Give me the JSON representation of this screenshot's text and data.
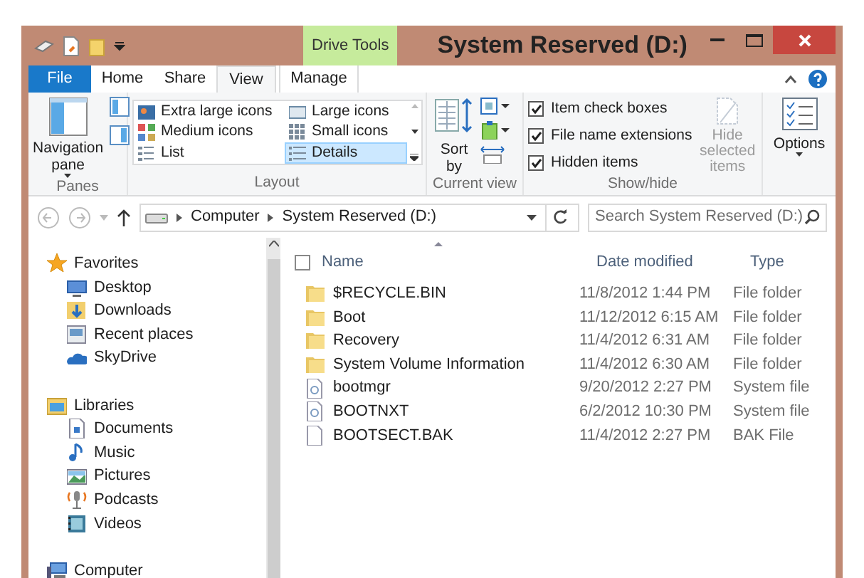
{
  "window": {
    "title": "System Reserved (D:)",
    "contextual_tab": "Drive Tools"
  },
  "ribbon_tabs": [
    {
      "label": "File",
      "kind": "file",
      "selected": false
    },
    {
      "label": "Home",
      "kind": "tab",
      "selected": false
    },
    {
      "label": "Share",
      "kind": "tab",
      "selected": false
    },
    {
      "label": "View",
      "kind": "tab",
      "selected": true
    },
    {
      "label": "Manage",
      "kind": "tab",
      "selected": false
    }
  ],
  "ribbon": {
    "panes": {
      "label": "Panes",
      "button": "Navigation pane"
    },
    "layout": {
      "label": "Layout",
      "options": [
        {
          "label": "Extra large icons",
          "selected": false
        },
        {
          "label": "Large icons",
          "selected": false
        },
        {
          "label": "Medium icons",
          "selected": false
        },
        {
          "label": "Small icons",
          "selected": false
        },
        {
          "label": "List",
          "selected": false
        },
        {
          "label": "Details",
          "selected": true
        }
      ]
    },
    "current_view": {
      "label": "Current view",
      "sort_button": "Sort by"
    },
    "show_hide": {
      "label": "Show/hide",
      "checkboxes": [
        {
          "label": "Item check boxes",
          "checked": true
        },
        {
          "label": "File name extensions",
          "checked": true
        },
        {
          "label": "Hidden items",
          "checked": true
        }
      ],
      "hide_button": {
        "label": "Hide selected items",
        "disabled": true
      }
    },
    "options": {
      "button": "Options"
    }
  },
  "address_bar": {
    "crumbs": [
      "Computer",
      "System Reserved (D:)"
    ],
    "search_placeholder": "Search System Reserved (D:)"
  },
  "navigation": [
    {
      "label": "Favorites",
      "kind": "star",
      "children": [
        {
          "label": "Desktop",
          "kind": "desktop"
        },
        {
          "label": "Downloads",
          "kind": "download"
        },
        {
          "label": "Recent places",
          "kind": "recent"
        },
        {
          "label": "SkyDrive",
          "kind": "cloud"
        }
      ]
    },
    {
      "label": "Libraries",
      "kind": "library",
      "children": [
        {
          "label": "Documents",
          "kind": "document"
        },
        {
          "label": "Music",
          "kind": "music"
        },
        {
          "label": "Pictures",
          "kind": "picture"
        },
        {
          "label": "Podcasts",
          "kind": "podcast"
        },
        {
          "label": "Videos",
          "kind": "video"
        }
      ]
    },
    {
      "label": "Computer",
      "kind": "computer"
    }
  ],
  "table": {
    "select_all_checked": false,
    "columns": [
      "Name",
      "Date modified",
      "Type"
    ],
    "rows": [
      {
        "kind": "folder",
        "name": "$RECYCLE.BIN",
        "date": "11/8/2012 1:44 PM",
        "type": "File folder"
      },
      {
        "kind": "folder",
        "name": "Boot",
        "date": "11/12/2012 6:15 AM",
        "type": "File folder"
      },
      {
        "kind": "folder",
        "name": "Recovery",
        "date": "11/4/2012 6:31 AM",
        "type": "File folder"
      },
      {
        "kind": "folder",
        "name": "System Volume Information",
        "date": "11/4/2012 6:30 AM",
        "type": "File folder"
      },
      {
        "kind": "system",
        "name": "bootmgr",
        "date": "9/20/2012 2:27 PM",
        "type": "System file"
      },
      {
        "kind": "system",
        "name": "BOOTNXT",
        "date": "6/2/2012 10:30 PM",
        "type": "System file"
      },
      {
        "kind": "file",
        "name": "BOOTSECT.BAK",
        "date": "11/4/2012 2:27 PM",
        "type": "BAK File"
      }
    ]
  }
}
